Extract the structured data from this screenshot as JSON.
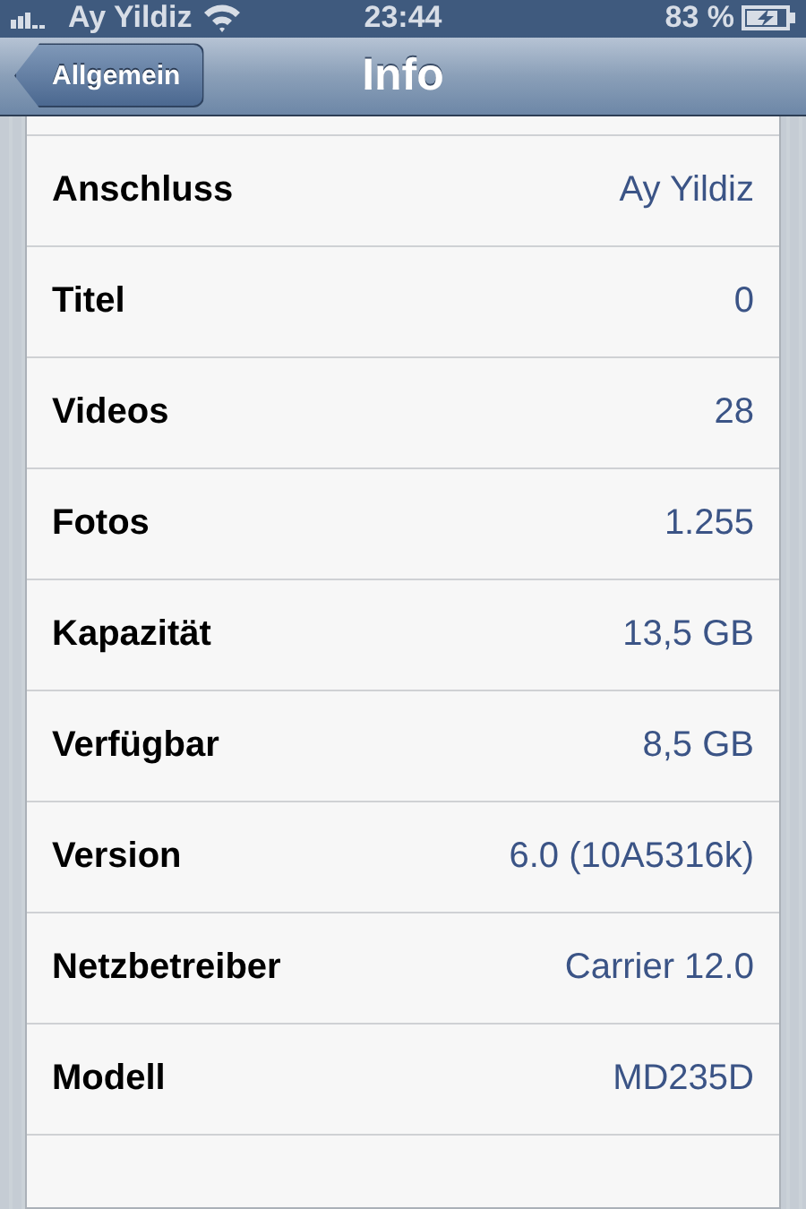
{
  "status_bar": {
    "carrier": "Ay Yildiz",
    "time": "23:44",
    "battery": "83 %"
  },
  "nav_bar": {
    "back": "Allgemein",
    "title": "Info"
  },
  "rows": [
    {
      "label": "Anschluss",
      "value": "Ay Yildiz"
    },
    {
      "label": "Titel",
      "value": "0"
    },
    {
      "label": "Videos",
      "value": "28"
    },
    {
      "label": "Fotos",
      "value": "1.255"
    },
    {
      "label": "Kapazität",
      "value": "13,5 GB"
    },
    {
      "label": "Verfügbar",
      "value": "8,5 GB"
    },
    {
      "label": "Version",
      "value": "6.0 (10A5316k)"
    },
    {
      "label": "Netzbetreiber",
      "value": "Carrier 12.0"
    },
    {
      "label": "Modell",
      "value": "MD235D"
    }
  ]
}
